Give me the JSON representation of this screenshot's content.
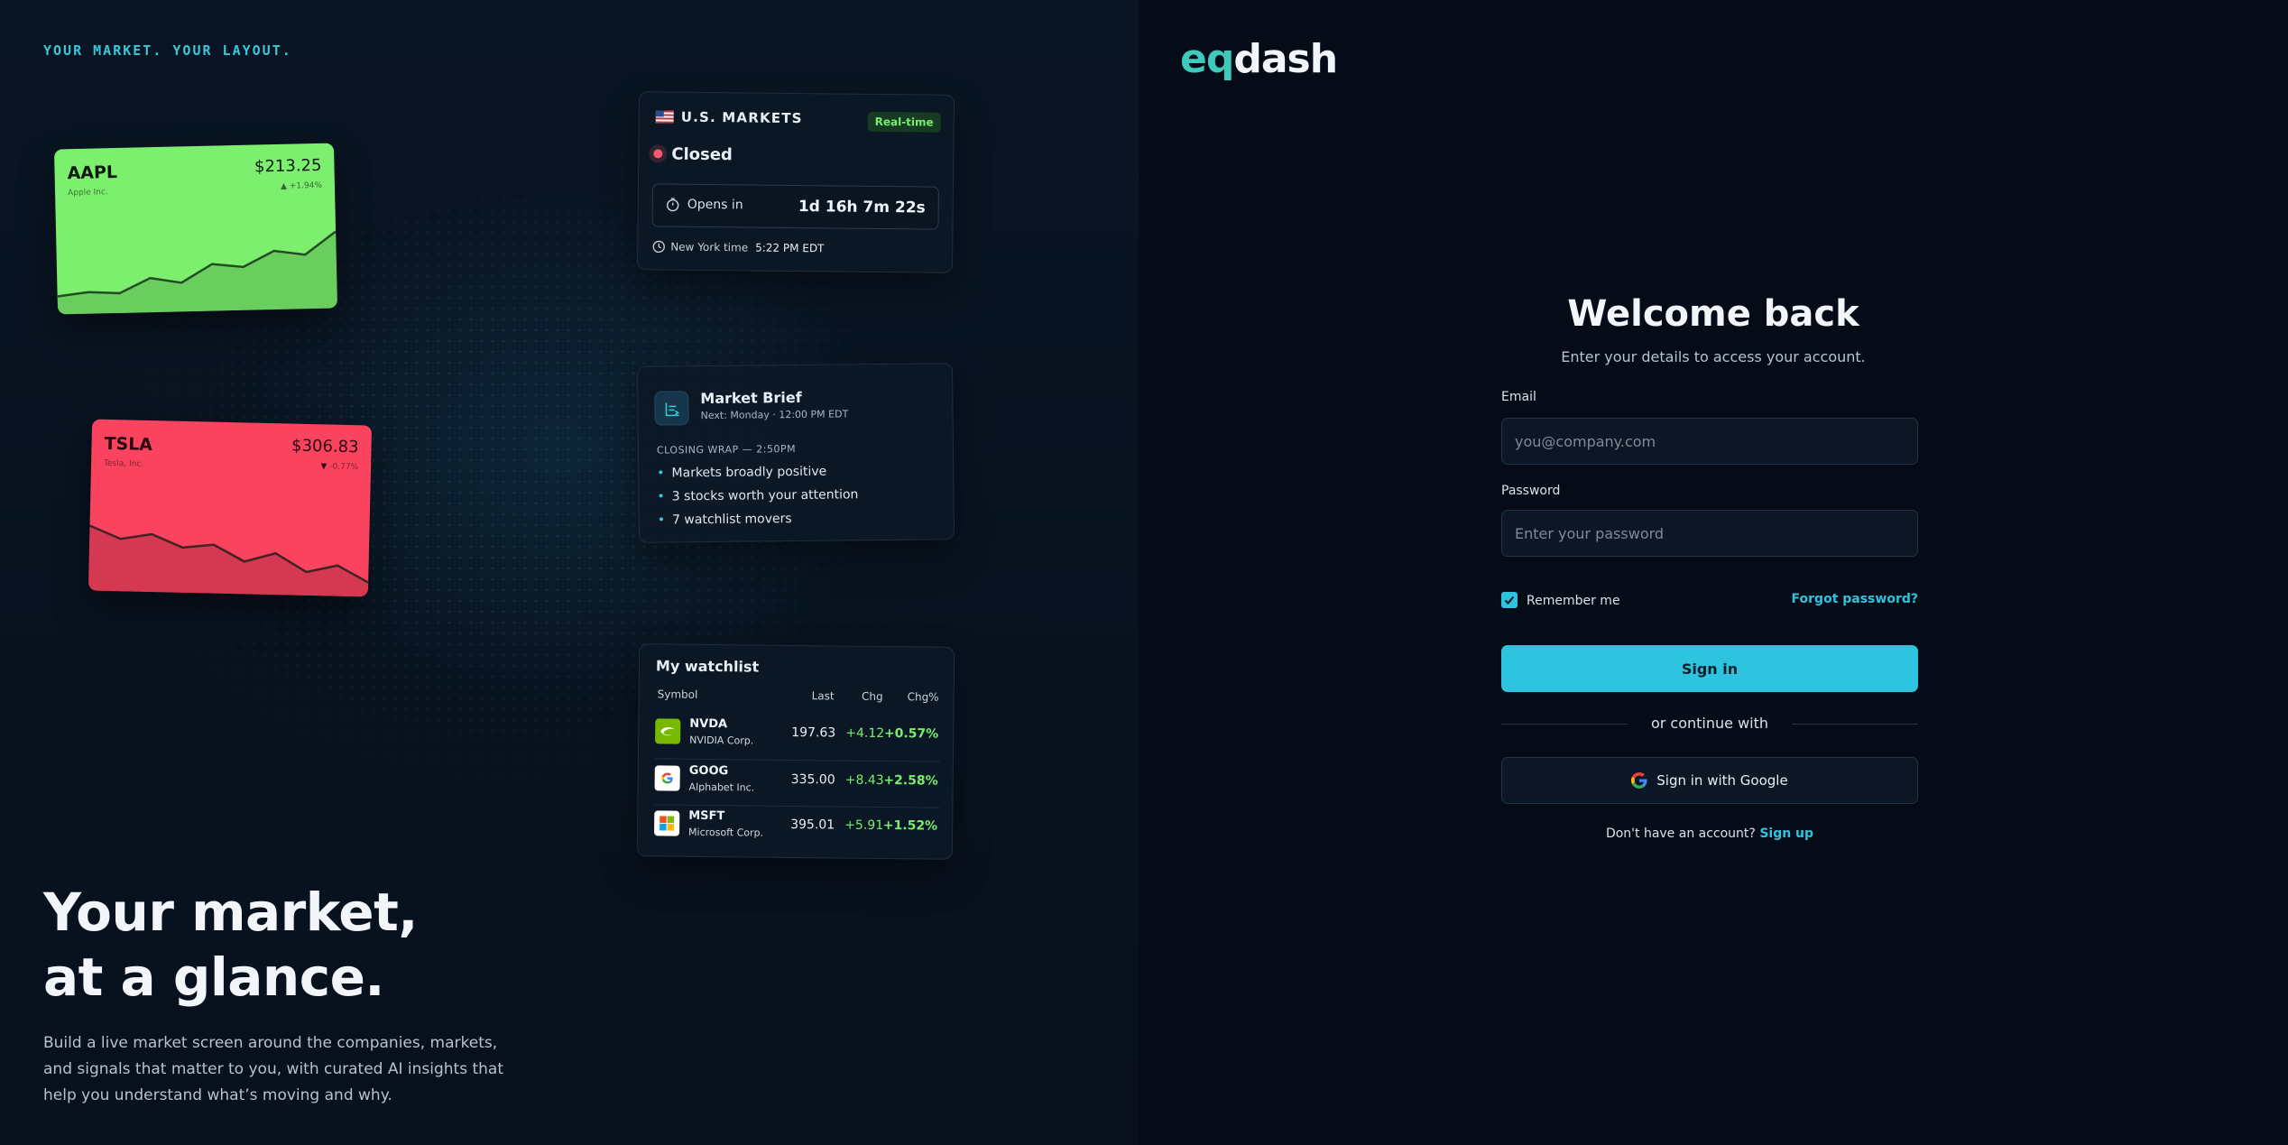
{
  "left": {
    "tagline": "YOUR MARKET. YOUR LAYOUT.",
    "hero_line1": "Your market,",
    "hero_line2": "at a glance.",
    "subtitle": "Build a live market screen around the companies, markets, and signals that matter to you, with curated AI insights that help you understand what’s moving and why."
  },
  "cards": [
    {
      "symbol": "AAPL",
      "name": "Apple Inc.",
      "price": "$213.25",
      "arrow": "▲",
      "change": "+1.94%",
      "color": "#7cf06e",
      "trend": [
        0.1,
        0.14,
        0.12,
        0.28,
        0.22,
        0.42,
        0.38,
        0.55,
        0.5,
        0.75
      ]
    },
    {
      "symbol": "TSLA",
      "name": "Tesla, Inc.",
      "price": "$306.83",
      "arrow": "▼",
      "change": "-0.77%",
      "color": "#f9435f",
      "trend": [
        0.62,
        0.48,
        0.54,
        0.4,
        0.44,
        0.26,
        0.36,
        0.16,
        0.24,
        0.06
      ]
    }
  ],
  "market": {
    "title": "U.S. MARKETS",
    "badge": "Real-time",
    "state": "Closed",
    "opens_label": "Opens in",
    "countdown": "1d 16h 7m 22s",
    "ny_label": "New York time",
    "ny_time": "5:22 PM EDT"
  },
  "brief": {
    "title": "Market Brief",
    "next": "Next: Monday · 12:00 PM EDT",
    "section": "CLOSING WRAP — 2:50PM",
    "items": [
      "Markets broadly positive",
      "3 stocks worth your attention",
      "7 watchlist movers"
    ]
  },
  "watchlist": {
    "title": "My watchlist",
    "headers": {
      "symbol": "Symbol",
      "last": "Last",
      "chg": "Chg",
      "chgpct": "Chg%"
    },
    "rows": [
      {
        "symbol": "NVDA",
        "name": "NVIDIA Corp.",
        "last": "197.63",
        "chg": "+4.12",
        "chgpct": "+0.57%",
        "logo": "nvidia-logo"
      },
      {
        "symbol": "GOOG",
        "name": "Alphabet Inc.",
        "last": "335.00",
        "chg": "+8.43",
        "chgpct": "+2.58%",
        "logo": "google-logo"
      },
      {
        "symbol": "MSFT",
        "name": "Microsoft Corp.",
        "last": "395.01",
        "chg": "+5.91",
        "chgpct": "+1.52%",
        "logo": "microsoft-logo"
      }
    ]
  },
  "auth": {
    "logo_eq": "eq",
    "logo_dash": "dash",
    "title": "Welcome back",
    "subtitle": "Enter your details to access your account.",
    "email_label": "Email",
    "email_placeholder": "you@company.com",
    "password_label": "Password",
    "password_placeholder": "Enter your password",
    "remember": "Remember me",
    "remember_checked": true,
    "forgot": "Forgot password?",
    "signin": "Sign in",
    "or": "or continue with",
    "google": "Sign in with Google",
    "no_account": "Don't have an account?",
    "signup": "Sign up"
  },
  "colors": {
    "accent": "#2ec4df",
    "brand_eq": "#3fc9bb",
    "positive": "#78ee6e",
    "negative": "#f9435f"
  }
}
